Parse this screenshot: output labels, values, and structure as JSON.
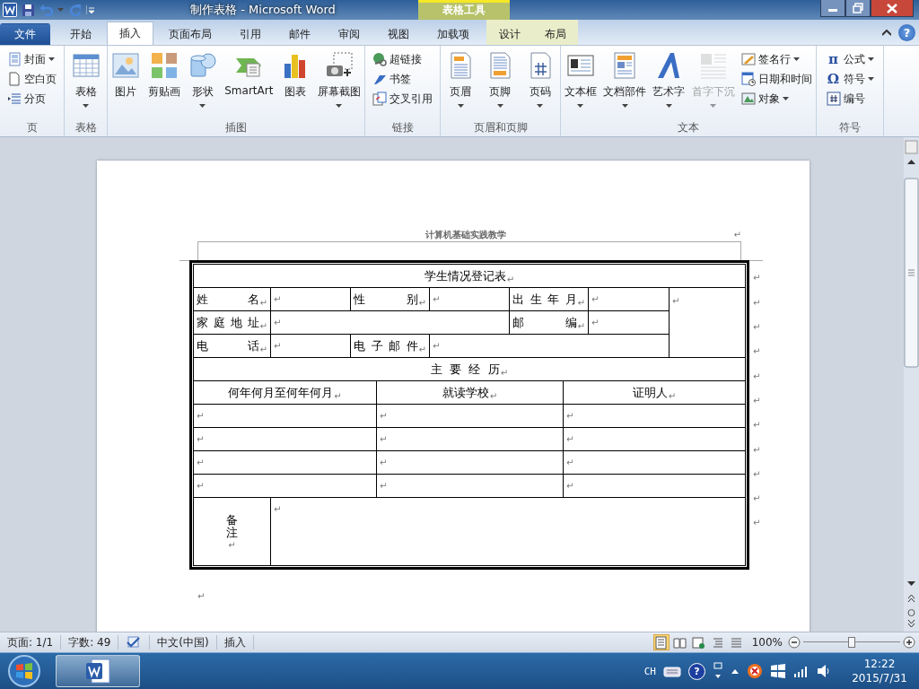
{
  "window": {
    "title": "制作表格 - Microsoft Word",
    "context_group": "表格工具"
  },
  "tabs": [
    {
      "label": "文件",
      "kind": "file",
      "selected": false
    },
    {
      "label": "开始",
      "kind": "normal",
      "selected": false
    },
    {
      "label": "插入",
      "kind": "normal",
      "selected": true
    },
    {
      "label": "页面布局",
      "kind": "normal",
      "selected": false
    },
    {
      "label": "引用",
      "kind": "normal",
      "selected": false
    },
    {
      "label": "邮件",
      "kind": "normal",
      "selected": false
    },
    {
      "label": "审阅",
      "kind": "normal",
      "selected": false
    },
    {
      "label": "视图",
      "kind": "normal",
      "selected": false
    },
    {
      "label": "加载项",
      "kind": "normal",
      "selected": false
    },
    {
      "label": "设计",
      "kind": "context",
      "selected": false
    },
    {
      "label": "布局",
      "kind": "context",
      "selected": false
    }
  ],
  "help_button": "?",
  "ribbon": {
    "groups": [
      {
        "label": "页",
        "items": [
          {
            "label": "封面",
            "kind": "small",
            "dropdown": true,
            "disabled": false
          },
          {
            "label": "空白页",
            "kind": "small",
            "dropdown": false,
            "disabled": false
          },
          {
            "label": "分页",
            "kind": "small",
            "dropdown": false,
            "disabled": false
          }
        ]
      },
      {
        "label": "表格",
        "items": [
          {
            "label": "表格",
            "kind": "large",
            "dropdown": true,
            "disabled": false
          }
        ]
      },
      {
        "label": "插图",
        "items": [
          {
            "label": "图片",
            "kind": "large",
            "dropdown": false,
            "disabled": false
          },
          {
            "label": "剪贴画",
            "kind": "large",
            "dropdown": false,
            "disabled": false
          },
          {
            "label": "形状",
            "kind": "large",
            "dropdown": true,
            "disabled": false
          },
          {
            "label": "SmartArt",
            "kind": "large",
            "dropdown": false,
            "disabled": false
          },
          {
            "label": "图表",
            "kind": "large",
            "dropdown": false,
            "disabled": false
          },
          {
            "label": "屏幕截图",
            "kind": "large",
            "dropdown": true,
            "disabled": false
          }
        ]
      },
      {
        "label": "链接",
        "items": [
          {
            "label": "超链接",
            "kind": "small",
            "dropdown": false,
            "disabled": false
          },
          {
            "label": "书签",
            "kind": "small",
            "dropdown": false,
            "disabled": false
          },
          {
            "label": "交叉引用",
            "kind": "small",
            "dropdown": false,
            "disabled": false
          }
        ]
      },
      {
        "label": "页眉和页脚",
        "items": [
          {
            "label": "页眉",
            "kind": "large",
            "dropdown": true,
            "disabled": false
          },
          {
            "label": "页脚",
            "kind": "large",
            "dropdown": true,
            "disabled": false
          },
          {
            "label": "页码",
            "kind": "large",
            "dropdown": true,
            "disabled": false
          }
        ]
      },
      {
        "label": "文本",
        "items": [
          {
            "label": "文本框",
            "kind": "large",
            "dropdown": true,
            "disabled": false
          },
          {
            "label": "文档部件",
            "kind": "large",
            "dropdown": true,
            "disabled": false
          },
          {
            "label": "艺术字",
            "kind": "large",
            "dropdown": true,
            "disabled": false
          },
          {
            "label": "首字下沉",
            "kind": "large",
            "dropdown": true,
            "disabled": true
          },
          {
            "label": "签名行",
            "kind": "small",
            "dropdown": true,
            "disabled": false
          },
          {
            "label": "日期和时间",
            "kind": "small",
            "dropdown": false,
            "disabled": false
          },
          {
            "label": "对象",
            "kind": "small",
            "dropdown": true,
            "disabled": false
          }
        ]
      },
      {
        "label": "符号",
        "items": [
          {
            "label": "公式",
            "kind": "small",
            "dropdown": true,
            "disabled": false,
            "icon_char": "π"
          },
          {
            "label": "符号",
            "kind": "small",
            "dropdown": true,
            "disabled": false,
            "icon_char": "Ω"
          },
          {
            "label": "编号",
            "kind": "small",
            "dropdown": false,
            "disabled": false
          }
        ]
      }
    ]
  },
  "document": {
    "header": {
      "text": "计算机基础实践教学",
      "mark": "↵"
    },
    "table": {
      "rows": [
        {
          "row_mark": "↵",
          "cells": [
            {
              "text": "学生情况登记表",
              "mark": "↵",
              "colspan": 9
            }
          ]
        },
        {
          "row_mark": "↵",
          "cells": [
            {
              "text": "姓名",
              "mark": "↵"
            },
            {
              "mark": "↵"
            },
            {
              "text": "性别",
              "mark": "↵",
              "colspan": 2
            },
            {
              "mark": "↵"
            },
            {
              "text": "出生年月",
              "mark": "↵",
              "colspan": 2
            },
            {
              "mark": "↵"
            },
            {
              "mark": "↵",
              "rowspan": 3
            }
          ]
        },
        {
          "row_mark": "↵",
          "cells": [
            {
              "text": "家庭地址",
              "mark": "↵"
            },
            {
              "mark": "↵",
              "colspan": 4
            },
            {
              "text": "邮编",
              "mark": "↵",
              "colspan": 2
            },
            {
              "mark": "↵"
            }
          ]
        },
        {
          "row_mark": "↵",
          "cells": [
            {
              "text": "电话",
              "mark": "↵"
            },
            {
              "mark": "↵"
            },
            {
              "text": "电子邮件",
              "mark": "↵",
              "colspan": 2
            },
            {
              "mark": "↵",
              "colspan": 4
            }
          ]
        },
        {
          "row_mark": "↵",
          "cells": [
            {
              "text": "主  要  经  历",
              "mark": "↵",
              "colspan": 9
            }
          ]
        },
        {
          "row_mark": "↵",
          "cells": [
            {
              "text": "何年何月至何年何月",
              "mark": "↵",
              "colspan": 3
            },
            {
              "text": "就读学校",
              "mark": "↵",
              "colspan": 3
            },
            {
              "text": "证明人",
              "mark": "↵",
              "colspan": 3
            }
          ]
        },
        {
          "row_mark": "↵",
          "cells": [
            {
              "mark": "↵",
              "colspan": 3
            },
            {
              "mark": "↵",
              "colspan": 3
            },
            {
              "mark": "↵",
              "colspan": 3
            }
          ]
        },
        {
          "row_mark": "↵",
          "cells": [
            {
              "mark": "↵",
              "colspan": 3
            },
            {
              "mark": "↵",
              "colspan": 3
            },
            {
              "mark": "↵",
              "colspan": 3
            }
          ]
        },
        {
          "row_mark": "↵",
          "cells": [
            {
              "mark": "↵",
              "colspan": 3
            },
            {
              "mark": "↵",
              "colspan": 3
            },
            {
              "mark": "↵",
              "colspan": 3
            }
          ]
        },
        {
          "row_mark": "↵",
          "cells": [
            {
              "mark": "↵",
              "colspan": 3
            },
            {
              "mark": "↵",
              "colspan": 3
            },
            {
              "mark": "↵",
              "colspan": 3
            }
          ]
        },
        {
          "row_mark": "↵",
          "cells": [
            {
              "text": "备注",
              "mark": "↵"
            },
            {
              "mark": "↵",
              "colspan": 8
            }
          ]
        }
      ]
    },
    "after_mark": "↵"
  },
  "status_bar": {
    "page": "页面: 1/1",
    "words": "字数: 49",
    "language": "中文(中国)",
    "mode": "插入",
    "views": [
      {
        "selected": true
      },
      {
        "selected": false
      },
      {
        "selected": false
      },
      {
        "selected": false
      },
      {
        "selected": false
      }
    ],
    "zoom": {
      "reading": "100%",
      "level": 0.5
    }
  },
  "taskbar": {
    "input_lang": "CH",
    "help": "?",
    "time": "12:22",
    "date": "2015/7/31"
  }
}
